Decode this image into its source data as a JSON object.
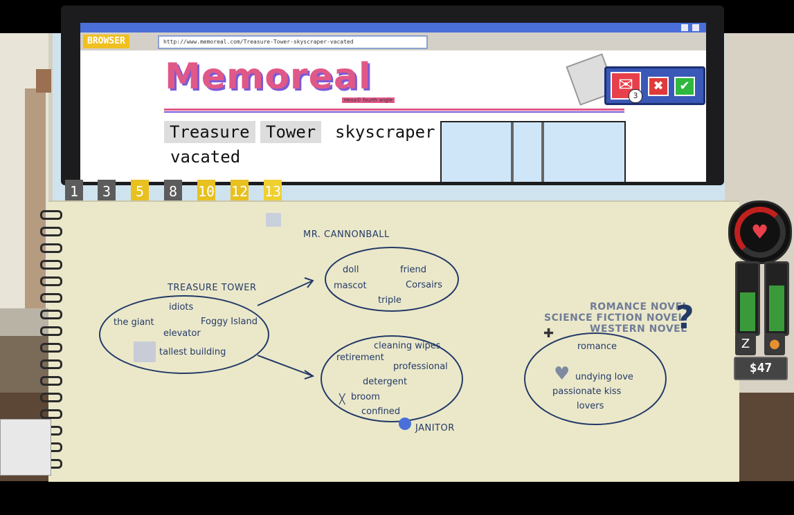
{
  "browser": {
    "tag": "BROWSER",
    "url": "http://www.memoreal.com/Treasure-Tower-skyscraper-vacated",
    "site_logo": "Memoreal",
    "site_sub": "Hexa© fourth angle",
    "headline_words": [
      "Treasure",
      "Tower",
      "skyscraper"
    ],
    "headline_line2": "vacated"
  },
  "mail": {
    "count": "3",
    "reject_glyph": "✖",
    "accept_glyph": "✔"
  },
  "tabs": [
    "1",
    "3",
    "5",
    "8",
    "10",
    "12",
    "13"
  ],
  "notebook": {
    "cannonball": {
      "title": "MR. CANNONBALL",
      "words": [
        "doll",
        "friend",
        "mascot",
        "Corsairs",
        "triple"
      ]
    },
    "treasure": {
      "title": "TREASURE TOWER",
      "words": [
        "idiots",
        "the giant",
        "Foggy Island",
        "elevator",
        "tallest building"
      ]
    },
    "janitor": {
      "title": "JANITOR",
      "words": [
        "cleaning wipes",
        "retirement",
        "professional",
        "detergent",
        "broom",
        "confined"
      ]
    },
    "novels": {
      "options": [
        "ROMANCE NOVEL",
        "SCIENCE FICTION NOVEL",
        "WESTERN NOVEL"
      ],
      "question": "?",
      "words": [
        "romance",
        "undying love",
        "passionate kiss",
        "lovers"
      ]
    }
  },
  "hud": {
    "money": "$47",
    "sleep_icon": "sleep-icon",
    "food_icon": "food-icon",
    "meter_left_level": 0.6,
    "meter_right_level": 0.7
  },
  "colors": {
    "ink": "#233a66",
    "accent_pink": "#e05888",
    "tab_gold": "#e8c020",
    "paper": "#ebe8ca"
  }
}
